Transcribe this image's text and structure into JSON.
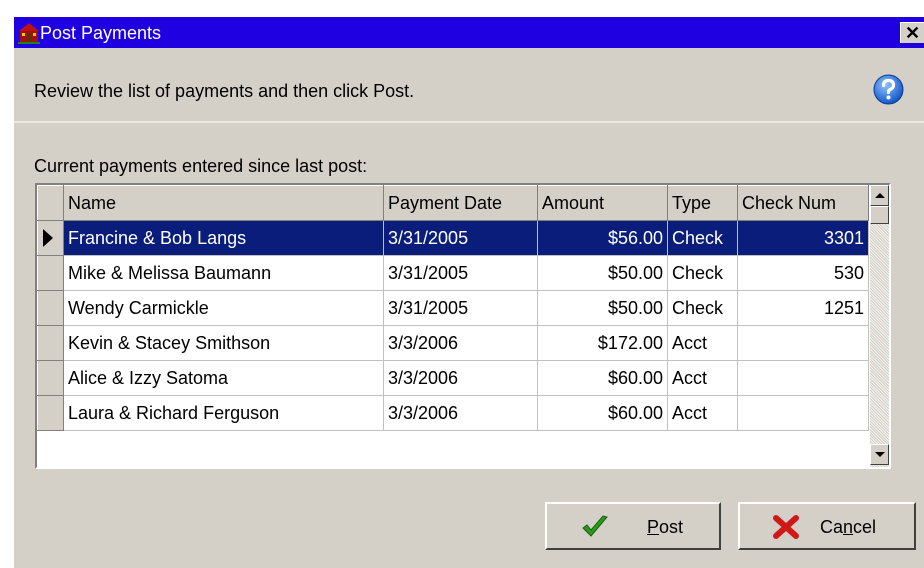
{
  "window": {
    "title": "Post Payments",
    "close_glyph": "✕",
    "app_icon": "house-icon",
    "help_icon": "help-icon"
  },
  "instruction": "Review the list of payments and then click Post.",
  "grid": {
    "caption": "Current payments entered since last post:",
    "columns": [
      "Name",
      "Payment Date",
      "Amount",
      "Type",
      "Check Num"
    ],
    "selected_row": 0,
    "rows": [
      {
        "name": "Francine & Bob Langs",
        "date": "3/31/2005",
        "amount": "$56.00",
        "type": "Check",
        "check_num": "3301"
      },
      {
        "name": "Mike & Melissa Baumann",
        "date": "3/31/2005",
        "amount": "$50.00",
        "type": "Check",
        "check_num": "530"
      },
      {
        "name": "Wendy Carmickle",
        "date": "3/31/2005",
        "amount": "$50.00",
        "type": "Check",
        "check_num": "1251"
      },
      {
        "name": "Kevin & Stacey Smithson",
        "date": "3/3/2006",
        "amount": "$172.00",
        "type": "Acct",
        "check_num": ""
      },
      {
        "name": "Alice & Izzy Satoma",
        "date": "3/3/2006",
        "amount": "$60.00",
        "type": "Acct",
        "check_num": ""
      },
      {
        "name": "Laura & Richard Ferguson",
        "date": "3/3/2006",
        "amount": "$60.00",
        "type": "Acct",
        "check_num": ""
      }
    ]
  },
  "buttons": {
    "post": {
      "mnemonic": "P",
      "rest": "ost",
      "icon": "checkmark-icon"
    },
    "cancel": {
      "pre": "Ca",
      "mnemonic": "n",
      "rest": "cel",
      "icon": "x-icon"
    }
  },
  "colors": {
    "titlebar": "#1f00e0",
    "selection": "#0a1d7a",
    "dialog": "#d4d0c8"
  }
}
